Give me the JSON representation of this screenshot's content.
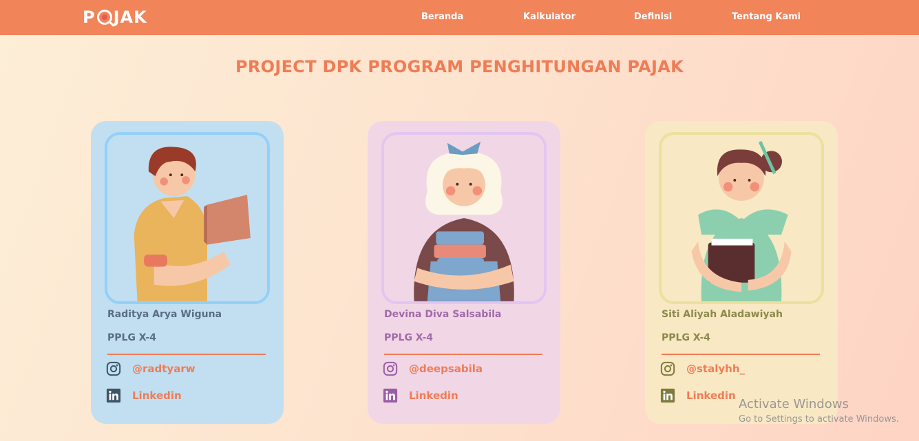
{
  "nav": {
    "logo": "PAJAK",
    "links": [
      "Beranda",
      "Kalkulator",
      "Definisi",
      "Tentang Kami"
    ]
  },
  "title": "PROJECT DPK PROGRAM PENGHITUNGAN PAJAK",
  "members": [
    {
      "name": "Raditya Arya Wiguna",
      "class": "PPLG X-4",
      "instagram": "@radtyarw",
      "linkedin": "Linkedin",
      "card_bg": "#c1dff0",
      "frame_border": "#93d0f7",
      "text_color": "#5b6d80",
      "icon_color": "#3e5466"
    },
    {
      "name": "Devina Diva Salsabila",
      "class": "PPLG X-4",
      "instagram": "@deepsabila",
      "linkedin": "Linkedin",
      "card_bg": "#f1d6e6",
      "frame_border": "#e3c5f2",
      "text_color": "#a06aa8",
      "icon_color": "#9a5ea6"
    },
    {
      "name": "Siti Aliyah Aladawiyah",
      "class": "PPLG X-4",
      "instagram": "@stalyhh_",
      "linkedin": "Linkedin",
      "card_bg": "#f8e8c4",
      "frame_border": "#ece09e",
      "text_color": "#8a8a4c",
      "icon_color": "#7d7b3e"
    }
  ],
  "watermark": {
    "line1": "Activate Windows",
    "line2": "Go to Settings to activate Windows."
  }
}
